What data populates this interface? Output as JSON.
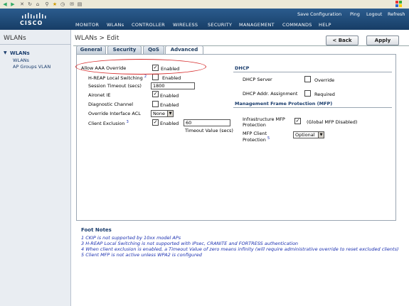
{
  "header": {
    "logo": "CISCO",
    "utility_links": [
      "Save Configuration",
      "Ping",
      "Logout",
      "Refresh"
    ],
    "nav": [
      "MONITOR",
      "WLANs",
      "CONTROLLER",
      "WIRELESS",
      "SECURITY",
      "MANAGEMENT",
      "COMMANDS",
      "HELP"
    ]
  },
  "sidebar": {
    "title": "WLANs",
    "section": "WLANs",
    "items": [
      "WLANs",
      "AP Groups VLAN"
    ]
  },
  "main": {
    "title": "WLANs > Edit",
    "back_label": "< Back",
    "apply_label": "Apply",
    "tabs": [
      "General",
      "Security",
      "QoS",
      "Advanced"
    ],
    "active_tab": "Advanced"
  },
  "form": {
    "aaa_override": {
      "label": "Allow AAA Override",
      "checked": true,
      "text": "Enabled"
    },
    "hreap": {
      "label": "H-REAP Local Switching",
      "sup": "2",
      "checked": false,
      "text": "Enabled"
    },
    "session_timeout": {
      "label": "Session Timeout (secs)",
      "value": "1800"
    },
    "aironet": {
      "label": "Aironet IE",
      "checked": true,
      "text": "Enabled"
    },
    "diagnostic": {
      "label": "Diagnostic Channel",
      "checked": false,
      "text": "Enabled"
    },
    "override_acl": {
      "label": "Override Interface ACL",
      "value": "None"
    },
    "client_exclusion": {
      "label": "Client Exclusion",
      "sup": "3",
      "checked": true,
      "text": "Enabled",
      "timeout_value": "60",
      "timeout_label": "Timeout Value (secs)"
    },
    "dhcp_title": "DHCP",
    "dhcp_server": {
      "label": "DHCP Server",
      "checked": false,
      "text": "Override"
    },
    "dhcp_assign": {
      "label": "DHCP Addr. Assignment",
      "checked": false,
      "text": "Required"
    },
    "mfp_title": "Management Frame Protection (MFP)",
    "infra_mfp": {
      "label1": "Infrastructure MFP",
      "label2": "Protection",
      "checked": true,
      "text": "(Global MFP Disabled)"
    },
    "client_mfp": {
      "label1": "MFP Client",
      "label2": "Protection",
      "sup": "5",
      "value": "Optional"
    }
  },
  "footnotes": {
    "title": "Foot Notes",
    "items": [
      "1 CKIP is not supported by 10xx model APs",
      "3 H-REAP Local Switching is not supported with IPsec, CRANITE and FORTRESS authentication",
      "4 When client exclusion is enabled, a Timeout Value of zero means infinity (will require administrative override to reset excluded clients)",
      "5 Client MFP is not active unless WPA2 is configured"
    ]
  },
  "colors": {
    "header": "#1f4c7c",
    "highlight_oval": "#d62a2a",
    "footnote_text": "#1a2fb0"
  }
}
